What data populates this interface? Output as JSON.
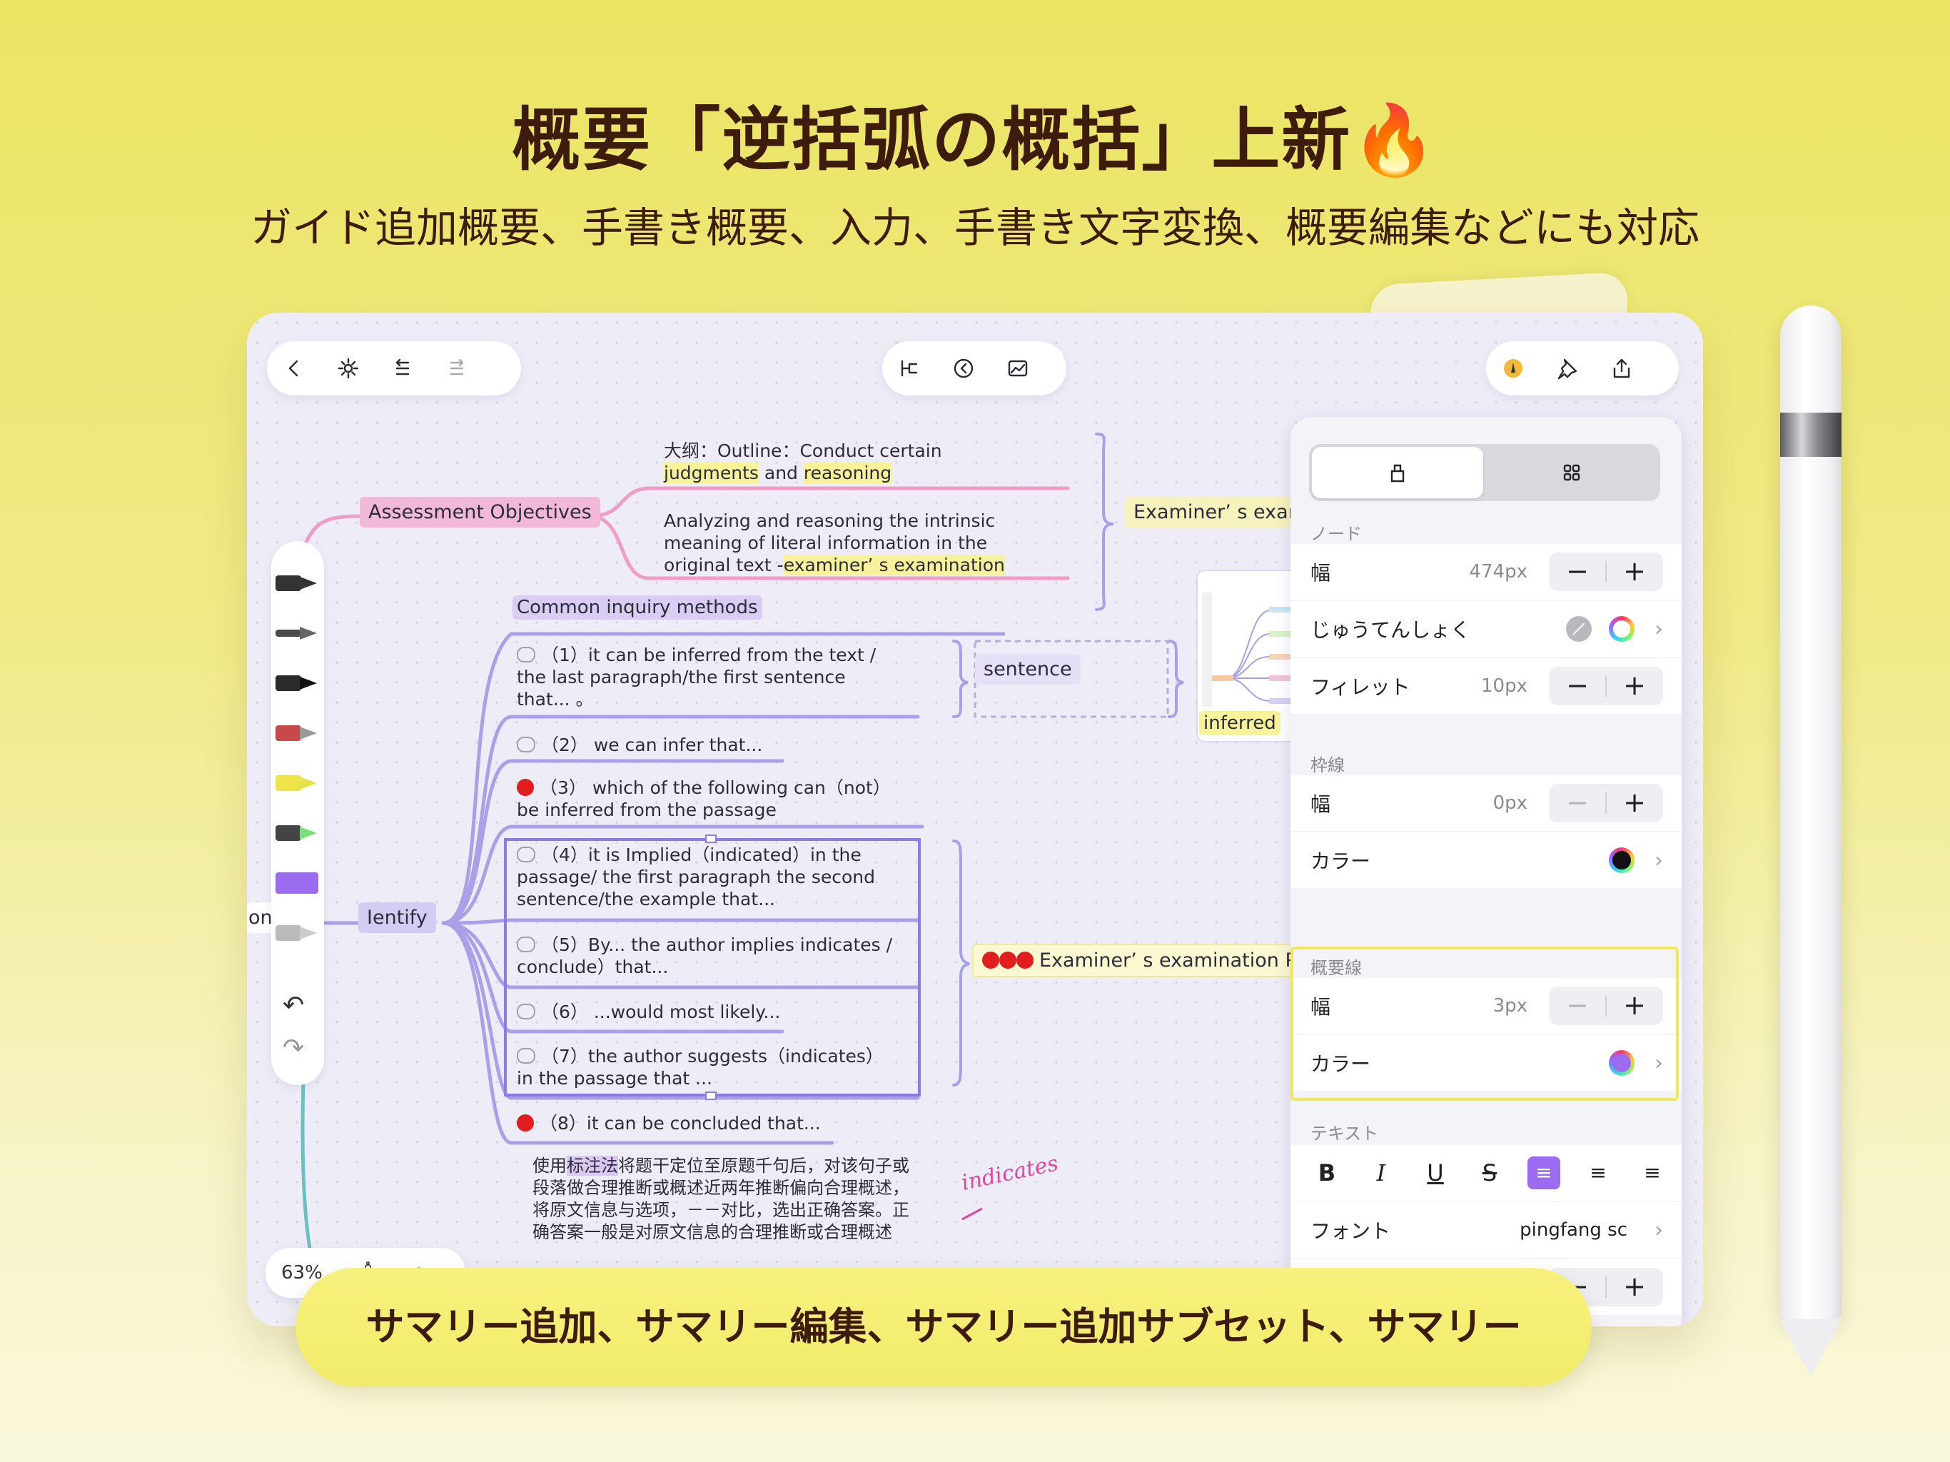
{
  "headline": "概要「逆括弧の概括」上新🔥",
  "subline": "ガイド追加概要、手書き概要、入力、手書き文字変換、概要編集などにも対応",
  "banner": "サマリー追加、サマリー編集、サマリー追加サブセット、サマリー",
  "colors": {
    "accent_purple": "#9b6cf0",
    "highlight_yellow": "#efe85a",
    "branch_purple": "#a9a0e8",
    "branch_pink": "#ef9dc6"
  },
  "mindmap": {
    "outline_1": "大纲：Outline：Conduct certain",
    "outline_2a": "judgments",
    "outline_2b": " and ",
    "outline_2c": "reasoning",
    "analyze_1": "Analyzing and reasoning the intrinsic",
    "analyze_2": "meaning of literal information in the",
    "analyze_3a": "original text -",
    "analyze_3b": "examiner’ s examination",
    "assessment": "Assessment Objectives",
    "examiner_top": "Examiner’ s exar",
    "common": "Common inquiry methods",
    "m1_1": "（1）it can be inferred from the text  /",
    "m1_2": "the last paragraph/the first sentence",
    "m1_3": "that... 。",
    "sentence": "sentence",
    "m2": "（2） we can infer that...",
    "m3_1": "（3） which of the following can（not）",
    "m3_2": "be inferred from the passage",
    "m4_1": "（4）it is Implied（indicated）in the",
    "m4_2": "passage/ the first paragraph the second",
    "m4_3": "sentence/the example that...",
    "m5_1": "（5）By... the author implies indicates /",
    "m5_2": "conclude）that...",
    "m6": "（6） ...would most likely...",
    "m7_1": "（7）the author suggests（indicates）",
    "m7_2": "in the passage that  ...",
    "m8": "（8）it can be concluded that...",
    "identify": "Ientify",
    "left_cut": "ons",
    "examiner_bottom": "Examiner’ s examination P",
    "inferred": "inferred",
    "handwriting": "indicates",
    "cn_pre": "使用",
    "cn_hl": "标注法",
    "cn_rest": "将题干定位至原题千句后，对该句子或段落做合理推断或概述近两年推断偏向合理概述，将原文信息与选项，－－对比，选出正确答案。正确答案一般是对原文信息的合理推断或合理概述"
  },
  "zoom": {
    "level": "63%"
  },
  "panel": {
    "tab_style_icon": "paint-bucket-icon",
    "tab_layout_icon": "grid-icon",
    "node_section": "ノード",
    "width_label": "幅",
    "width_value": "474px",
    "fill_label": "じゅうてんしょく",
    "fillet_label": "フィレット",
    "fillet_value": "10px",
    "border_section": "枠線",
    "border_width_label": "幅",
    "border_width_value": "0px",
    "border_color_label": "カラー",
    "summary_section": "概要線",
    "summary_width_label": "幅",
    "summary_width_value": "3px",
    "summary_color_label": "カラー",
    "text_section": "テキスト",
    "bold": "B",
    "italic": "I",
    "underline": "U",
    "strike": "S",
    "font_label": "フォント",
    "font_value": "pingfang sc",
    "minus": "−",
    "plus": "+",
    "chevron": "›"
  }
}
